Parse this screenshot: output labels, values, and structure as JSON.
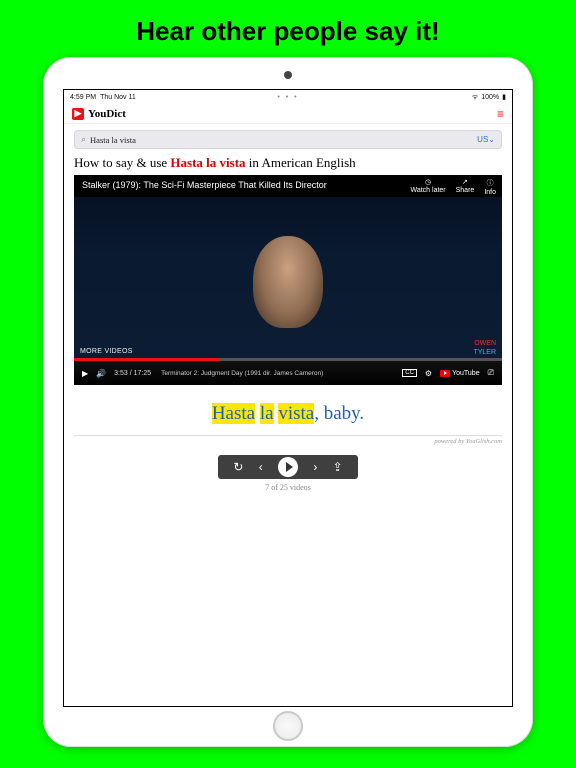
{
  "promo": {
    "title": "Hear other people say it!"
  },
  "status": {
    "time": "4:59 PM",
    "date": "Thu Nov 11",
    "center_dots": "• • •",
    "wifi_icon_name": "wifi-icon",
    "battery_text": "100%"
  },
  "header": {
    "brand": "YouDict",
    "menu_icon_name": "hamburger-icon"
  },
  "search": {
    "value": "Hasta la vista",
    "lang_label": "US",
    "icon_name": "search-icon"
  },
  "headline": {
    "prefix": "How to say & use ",
    "term": "Hasta la vista",
    "suffix": " in American English"
  },
  "video": {
    "title": "Stalker (1979): The Sci-Fi Masterpiece That Killed Its Director",
    "top_buttons": [
      {
        "icon": "clock-icon",
        "label": "Watch later"
      },
      {
        "icon": "share-icon",
        "label": "Share"
      },
      {
        "icon": "info-icon",
        "label": "Info"
      }
    ],
    "more_videos_label": "MORE VIDEOS",
    "side_labels": {
      "top": "OWEN",
      "bottom": "TYLER"
    },
    "controls": {
      "play_icon": "play-icon",
      "volume_icon": "volume-icon",
      "time_label": "3:53 / 17:25",
      "subtitle_text": "Terminator 2: Judgment Day (1991 dir. James Cameron)",
      "cc_label": "CC",
      "settings_icon": "gear-icon",
      "youtube_label": "YouTube",
      "cast_icon": "cast-icon"
    }
  },
  "caption": {
    "words": [
      {
        "text": "Hasta",
        "highlight": true
      },
      {
        "text": "la",
        "highlight": true
      },
      {
        "text": "vista",
        "highlight": true
      }
    ],
    "rest": ", baby."
  },
  "footer": {
    "powered_by": "powered by YouGlish.com",
    "counter": "7 of 25 videos"
  },
  "nav": {
    "replay_icon": "replay-icon",
    "prev_icon": "chevron-left-icon",
    "play_icon": "play-icon",
    "next_icon": "chevron-right-icon",
    "share_icon": "share-icon"
  }
}
